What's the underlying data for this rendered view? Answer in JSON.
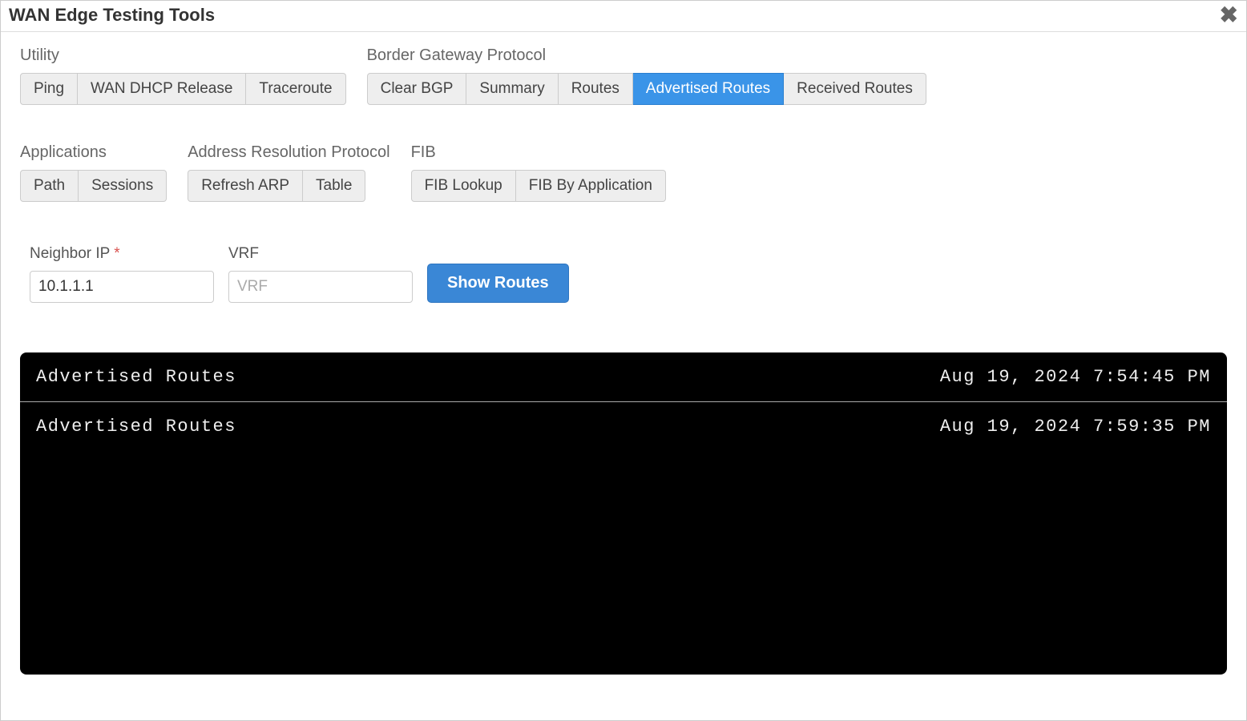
{
  "header": {
    "title": "WAN Edge Testing Tools"
  },
  "groups": {
    "utility": {
      "label": "Utility",
      "buttons": {
        "ping": "Ping",
        "dhcp": "WAN DHCP Release",
        "trace": "Traceroute"
      }
    },
    "bgp": {
      "label": "Border Gateway Protocol",
      "buttons": {
        "clear": "Clear BGP",
        "summary": "Summary",
        "routes": "Routes",
        "adv": "Advertised Routes",
        "recv": "Received Routes"
      }
    },
    "apps": {
      "label": "Applications",
      "buttons": {
        "path": "Path",
        "sessions": "Sessions"
      }
    },
    "arp": {
      "label": "Address Resolution Protocol",
      "buttons": {
        "refresh": "Refresh ARP",
        "table": "Table"
      }
    },
    "fib": {
      "label": "FIB",
      "buttons": {
        "lookup": "FIB Lookup",
        "byapp": "FIB By Application"
      }
    }
  },
  "form": {
    "neighbor": {
      "label": "Neighbor IP ",
      "value": "10.1.1.1"
    },
    "vrf": {
      "label": "VRF",
      "placeholder": "VRF",
      "value": ""
    },
    "submit": "Show Routes"
  },
  "terminal": {
    "rows": [
      {
        "label": "Advertised Routes",
        "timestamp": "Aug 19, 2024 7:54:45 PM"
      },
      {
        "label": "Advertised Routes",
        "timestamp": "Aug 19, 2024 7:59:35 PM"
      }
    ]
  }
}
